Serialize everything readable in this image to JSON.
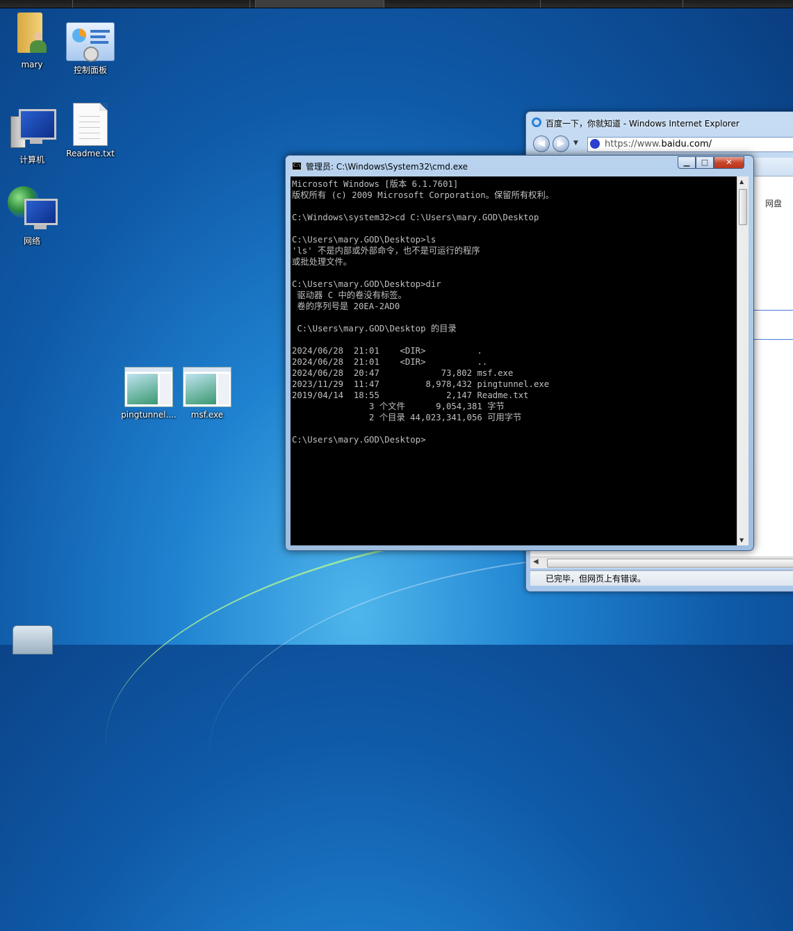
{
  "desktop": {
    "icons": [
      {
        "label": "mary",
        "icon": "user-folder-icon"
      },
      {
        "label": "控制面板",
        "icon": "control-panel-icon"
      },
      {
        "label": "计算机",
        "icon": "computer-icon"
      },
      {
        "label": "Readme.txt",
        "icon": "text-file-icon"
      },
      {
        "label": "网络",
        "icon": "network-icon"
      },
      {
        "label": "pingtunnel....",
        "icon": "exe-file-icon"
      },
      {
        "label": "msf.exe",
        "icon": "exe-file-icon"
      }
    ]
  },
  "ie_window": {
    "title": "百度一下，你就知道 - Windows Internet Explorer",
    "address_proto": "https://www.",
    "address_host": "baidu.com/",
    "content_side_text": "网盘",
    "status_text": "已完毕，但网页上有错误。"
  },
  "cmd_window": {
    "title": "管理员: C:\\Windows\\System32\\cmd.exe",
    "buttons": {
      "minimize": "▁",
      "maximize": "□",
      "close": "✕"
    },
    "output": "Microsoft Windows [版本 6.1.7601]\n版权所有 (c) 2009 Microsoft Corporation。保留所有权利。\n\nC:\\Windows\\system32>cd C:\\Users\\mary.GOD\\Desktop\n\nC:\\Users\\mary.GOD\\Desktop>ls\n'ls' 不是内部或外部命令，也不是可运行的程序\n或批处理文件。\n\nC:\\Users\\mary.GOD\\Desktop>dir\n 驱动器 C 中的卷没有标签。\n 卷的序列号是 20EA-2AD0\n\n C:\\Users\\mary.GOD\\Desktop 的目录\n\n2024/06/28  21:01    <DIR>          .\n2024/06/28  21:01    <DIR>          ..\n2024/06/28  20:47            73,802 msf.exe\n2023/11/29  11:47         8,978,432 pingtunnel.exe\n2019/04/14  18:55             2,147 Readme.txt\n               3 个文件      9,054,381 字节\n               2 个目录 44,023,341,056 可用字节\n\nC:\\Users\\mary.GOD\\Desktop>"
  },
  "colors": {
    "console_bg": "#000000",
    "console_text": "#c0c0c0",
    "close_button": "#c7452c"
  }
}
